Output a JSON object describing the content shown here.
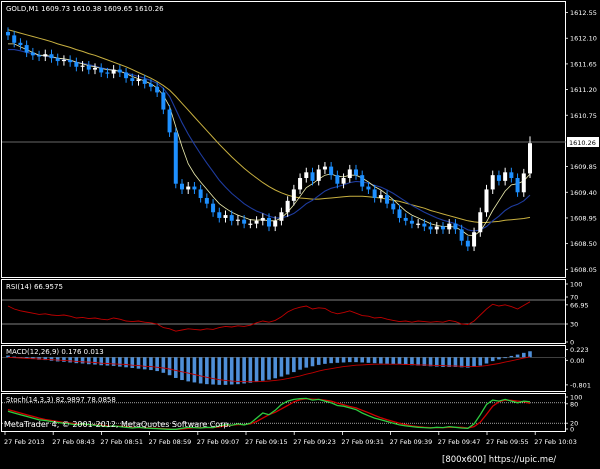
{
  "main_panel": {
    "header": "GOLD,M1  1609.73 1610.38 1609.65 1610.26",
    "y_ticks": [
      "1612.55",
      "1612.10",
      "1611.65",
      "1611.20",
      "1610.75",
      "1610.26",
      "1609.85",
      "1609.40",
      "1608.95",
      "1608.50",
      "1608.05"
    ],
    "current_price": "1610.26"
  },
  "rsi_panel": {
    "header": "RSI(14) 66.9575",
    "y_ticks": [
      "100",
      "70",
      "66.95",
      "30",
      "0"
    ]
  },
  "macd_panel": {
    "header": "MACD(12,26,9) 0.176 0.013",
    "y_ticks": [
      "0.223",
      "0.00",
      "-0.801"
    ]
  },
  "stoch_panel": {
    "header": "Stoch(14,3,3) 82.9897 78.0858",
    "y_ticks": [
      "100",
      "80",
      "20",
      "0"
    ]
  },
  "x_ticks": [
    "27 Feb 2013",
    "27 Feb 08:43",
    "27 Feb 08:51",
    "27 Feb 08:59",
    "27 Feb 09:07",
    "27 Feb 09:15",
    "27 Feb 09:23",
    "27 Feb 09:31",
    "27 Feb 09:39",
    "27 Feb 09:47",
    "27 Feb 09:55",
    "27 Feb 10:03"
  ],
  "footer": "MetaTrader 4, © 2001-2012, MetaQuotes Software Corp.",
  "watermark": "[800x600] https://upic.me/",
  "colors": {
    "background": "#000000",
    "grid": "#ffffff",
    "bull_candle": "#ffffff",
    "bear_candle": "#1e90ff",
    "ma_fast": "#f0f0b0",
    "ma_mid": "#1e3ca0",
    "ma_slow": "#c8b040",
    "rsi_line": "#c00000",
    "macd_hist": "#4f8fd8",
    "macd_signal": "#c00000",
    "stoch_main": "#2ecc40",
    "stoch_signal": "#d00000"
  },
  "chart_data": {
    "type": "candlestick",
    "instrument": "GOLD",
    "timeframe": "M1",
    "ohlc_last": {
      "open": 1609.73,
      "high": 1610.38,
      "low": 1609.65,
      "close": 1610.26
    },
    "close": [
      1612.15,
      1612.02,
      1611.98,
      1611.85,
      1611.8,
      1611.78,
      1611.82,
      1611.75,
      1611.7,
      1611.72,
      1611.68,
      1611.6,
      1611.62,
      1611.55,
      1611.58,
      1611.5,
      1611.48,
      1611.55,
      1611.5,
      1611.4,
      1611.35,
      1611.38,
      1611.3,
      1611.25,
      1611.15,
      1610.85,
      1610.45,
      1609.55,
      1609.45,
      1609.5,
      1609.45,
      1609.3,
      1609.2,
      1609.05,
      1608.95,
      1609.0,
      1608.9,
      1608.92,
      1608.85,
      1608.85,
      1608.9,
      1608.95,
      1608.8,
      1608.9,
      1609.05,
      1609.25,
      1609.45,
      1609.65,
      1609.75,
      1609.6,
      1609.8,
      1609.85,
      1609.7,
      1609.55,
      1609.65,
      1609.8,
      1609.7,
      1609.5,
      1609.45,
      1609.3,
      1609.35,
      1609.2,
      1609.1,
      1608.95,
      1608.9,
      1608.85,
      1608.85,
      1608.8,
      1608.75,
      1608.8,
      1608.75,
      1608.85,
      1608.75,
      1608.55,
      1608.45,
      1608.7,
      1609.05,
      1609.45,
      1609.7,
      1609.6,
      1609.75,
      1609.65,
      1609.4,
      1609.73,
      1610.26
    ],
    "rsi": [
      60,
      55,
      52,
      50,
      48,
      46,
      47,
      45,
      44,
      45,
      43,
      40,
      41,
      39,
      40,
      38,
      37,
      40,
      38,
      35,
      34,
      35,
      33,
      32,
      30,
      24,
      22,
      18,
      20,
      22,
      21,
      20,
      22,
      21,
      24,
      26,
      25,
      27,
      26,
      28,
      32,
      35,
      33,
      36,
      42,
      50,
      55,
      58,
      60,
      55,
      57,
      56,
      50,
      47,
      49,
      52,
      48,
      44,
      43,
      40,
      41,
      38,
      36,
      34,
      35,
      33,
      35,
      34,
      33,
      34,
      33,
      36,
      34,
      30,
      29,
      35,
      45,
      55,
      63,
      60,
      62,
      59,
      55,
      61,
      66.96
    ],
    "macd_hist": [
      0.05,
      0.02,
      -0.01,
      -0.03,
      -0.05,
      -0.07,
      -0.08,
      -0.1,
      -0.12,
      -0.13,
      -0.15,
      -0.17,
      -0.18,
      -0.2,
      -0.21,
      -0.23,
      -0.24,
      -0.25,
      -0.27,
      -0.29,
      -0.31,
      -0.33,
      -0.35,
      -0.37,
      -0.4,
      -0.45,
      -0.52,
      -0.6,
      -0.66,
      -0.7,
      -0.73,
      -0.76,
      -0.78,
      -0.79,
      -0.8,
      -0.8,
      -0.79,
      -0.78,
      -0.76,
      -0.74,
      -0.71,
      -0.68,
      -0.65,
      -0.61,
      -0.56,
      -0.5,
      -0.43,
      -0.36,
      -0.3,
      -0.26,
      -0.22,
      -0.19,
      -0.17,
      -0.16,
      -0.15,
      -0.14,
      -0.14,
      -0.15,
      -0.16,
      -0.17,
      -0.18,
      -0.19,
      -0.2,
      -0.21,
      -0.22,
      -0.23,
      -0.24,
      -0.25,
      -0.26,
      -0.27,
      -0.28,
      -0.28,
      -0.28,
      -0.29,
      -0.3,
      -0.28,
      -0.24,
      -0.18,
      -0.11,
      -0.06,
      -0.01,
      0.04,
      0.08,
      0.13,
      0.176
    ],
    "macd_signal": [
      0.0,
      -0.01,
      -0.02,
      -0.03,
      -0.04,
      -0.05,
      -0.06,
      -0.07,
      -0.08,
      -0.09,
      -0.1,
      -0.12,
      -0.13,
      -0.14,
      -0.15,
      -0.17,
      -0.18,
      -0.19,
      -0.2,
      -0.21,
      -0.23,
      -0.24,
      -0.26,
      -0.27,
      -0.29,
      -0.31,
      -0.34,
      -0.38,
      -0.42,
      -0.46,
      -0.5,
      -0.54,
      -0.58,
      -0.62,
      -0.65,
      -0.67,
      -0.69,
      -0.7,
      -0.71,
      -0.71,
      -0.71,
      -0.7,
      -0.69,
      -0.67,
      -0.65,
      -0.62,
      -0.58,
      -0.54,
      -0.49,
      -0.45,
      -0.4,
      -0.36,
      -0.33,
      -0.3,
      -0.27,
      -0.25,
      -0.23,
      -0.22,
      -0.21,
      -0.2,
      -0.2,
      -0.2,
      -0.2,
      -0.2,
      -0.21,
      -0.21,
      -0.22,
      -0.22,
      -0.23,
      -0.24,
      -0.24,
      -0.25,
      -0.25,
      -0.26,
      -0.27,
      -0.27,
      -0.26,
      -0.24,
      -0.21,
      -0.18,
      -0.14,
      -0.1,
      -0.06,
      -0.02,
      0.013
    ],
    "stoch_main": [
      55,
      50,
      45,
      40,
      35,
      30,
      28,
      25,
      22,
      20,
      18,
      15,
      18,
      16,
      14,
      12,
      10,
      12,
      10,
      8,
      6,
      8,
      6,
      5,
      4,
      3,
      2,
      2,
      5,
      8,
      7,
      6,
      8,
      7,
      12,
      16,
      14,
      18,
      15,
      20,
      35,
      50,
      45,
      58,
      75,
      85,
      90,
      92,
      93,
      88,
      90,
      85,
      80,
      72,
      70,
      65,
      60,
      50,
      42,
      35,
      30,
      25,
      20,
      15,
      12,
      10,
      8,
      7,
      6,
      8,
      7,
      10,
      8,
      6,
      5,
      18,
      45,
      75,
      88,
      85,
      90,
      85,
      80,
      85,
      82.99
    ],
    "stoch_signal": [
      60,
      55,
      50,
      45,
      40,
      35,
      31,
      28,
      25,
      22,
      20,
      18,
      17,
      16,
      15,
      14,
      12,
      11,
      11,
      10,
      8,
      7,
      7,
      6,
      5,
      4,
      3,
      2,
      3,
      5,
      7,
      7,
      7,
      7,
      9,
      12,
      14,
      16,
      16,
      18,
      25,
      35,
      45,
      52,
      62,
      72,
      83,
      89,
      92,
      91,
      90,
      88,
      85,
      79,
      74,
      69,
      65,
      58,
      51,
      43,
      36,
      30,
      25,
      20,
      16,
      12,
      10,
      8,
      7,
      7,
      7,
      8,
      8,
      8,
      6,
      10,
      23,
      46,
      70,
      83,
      88,
      87,
      85,
      83,
      78.09
    ],
    "ma_fast": [
      1612.0,
      1612.0,
      1611.95,
      1611.9,
      1611.85,
      1611.8,
      1611.8,
      1611.78,
      1611.75,
      1611.74,
      1611.72,
      1611.68,
      1611.65,
      1611.62,
      1611.6,
      1611.57,
      1611.55,
      1611.54,
      1611.52,
      1611.48,
      1611.43,
      1611.39,
      1611.35,
      1611.3,
      1611.23,
      1611.1,
      1610.9,
      1610.55,
      1610.2,
      1609.9,
      1609.72,
      1609.58,
      1609.45,
      1609.32,
      1609.2,
      1609.12,
      1609.05,
      1609.0,
      1608.96,
      1608.92,
      1608.91,
      1608.92,
      1608.9,
      1608.9,
      1608.95,
      1609.05,
      1609.18,
      1609.33,
      1609.48,
      1609.55,
      1609.63,
      1609.7,
      1609.72,
      1609.68,
      1609.67,
      1609.7,
      1609.7,
      1609.65,
      1609.58,
      1609.5,
      1609.44,
      1609.36,
      1609.27,
      1609.17,
      1609.07,
      1609.0,
      1608.95,
      1608.9,
      1608.85,
      1608.82,
      1608.8,
      1608.8,
      1608.79,
      1608.73,
      1608.65,
      1608.64,
      1608.72,
      1608.88,
      1609.08,
      1609.25,
      1609.42,
      1609.53,
      1609.55,
      1609.6,
      1609.72
    ],
    "ma_mid": [
      1611.9,
      1611.9,
      1611.88,
      1611.85,
      1611.83,
      1611.8,
      1611.79,
      1611.77,
      1611.75,
      1611.73,
      1611.71,
      1611.68,
      1611.66,
      1611.64,
      1611.61,
      1611.58,
      1611.56,
      1611.54,
      1611.52,
      1611.49,
      1611.46,
      1611.43,
      1611.4,
      1611.36,
      1611.31,
      1611.22,
      1611.08,
      1610.85,
      1610.62,
      1610.42,
      1610.24,
      1610.07,
      1609.91,
      1609.76,
      1609.61,
      1609.49,
      1609.38,
      1609.29,
      1609.2,
      1609.13,
      1609.07,
      1609.03,
      1608.98,
      1608.95,
      1608.95,
      1608.98,
      1609.03,
      1609.11,
      1609.2,
      1609.26,
      1609.34,
      1609.42,
      1609.47,
      1609.5,
      1609.53,
      1609.57,
      1609.59,
      1609.58,
      1609.56,
      1609.52,
      1609.49,
      1609.44,
      1609.38,
      1609.31,
      1609.24,
      1609.17,
      1609.11,
      1609.05,
      1609.0,
      1608.95,
      1608.91,
      1608.88,
      1608.85,
      1608.8,
      1608.74,
      1608.72,
      1608.74,
      1608.8,
      1608.9,
      1608.98,
      1609.08,
      1609.15,
      1609.19,
      1609.25,
      1609.35
    ],
    "ma_slow": [
      1612.25,
      1612.22,
      1612.19,
      1612.16,
      1612.13,
      1612.1,
      1612.07,
      1612.04,
      1612.0,
      1611.97,
      1611.94,
      1611.9,
      1611.87,
      1611.83,
      1611.8,
      1611.76,
      1611.72,
      1611.68,
      1611.64,
      1611.6,
      1611.55,
      1611.5,
      1611.45,
      1611.4,
      1611.34,
      1611.27,
      1611.19,
      1611.08,
      1610.96,
      1610.84,
      1610.72,
      1610.6,
      1610.48,
      1610.36,
      1610.24,
      1610.13,
      1610.02,
      1609.92,
      1609.82,
      1609.73,
      1609.65,
      1609.57,
      1609.5,
      1609.44,
      1609.39,
      1609.35,
      1609.32,
      1609.3,
      1609.29,
      1609.28,
      1609.28,
      1609.29,
      1609.3,
      1609.31,
      1609.32,
      1609.33,
      1609.33,
      1609.33,
      1609.32,
      1609.31,
      1609.3,
      1609.28,
      1609.26,
      1609.24,
      1609.21,
      1609.18,
      1609.15,
      1609.12,
      1609.08,
      1609.05,
      1609.02,
      1608.99,
      1608.96,
      1608.93,
      1608.9,
      1608.88,
      1608.87,
      1608.87,
      1608.88,
      1608.89,
      1608.91,
      1608.92,
      1608.93,
      1608.94,
      1608.96
    ],
    "y_range_main": [
      1607.95,
      1612.7
    ],
    "y_range_rsi": [
      0,
      100
    ],
    "y_range_stoch": [
      0,
      100
    ],
    "y_range_macd": [
      -0.95,
      0.3
    ]
  }
}
